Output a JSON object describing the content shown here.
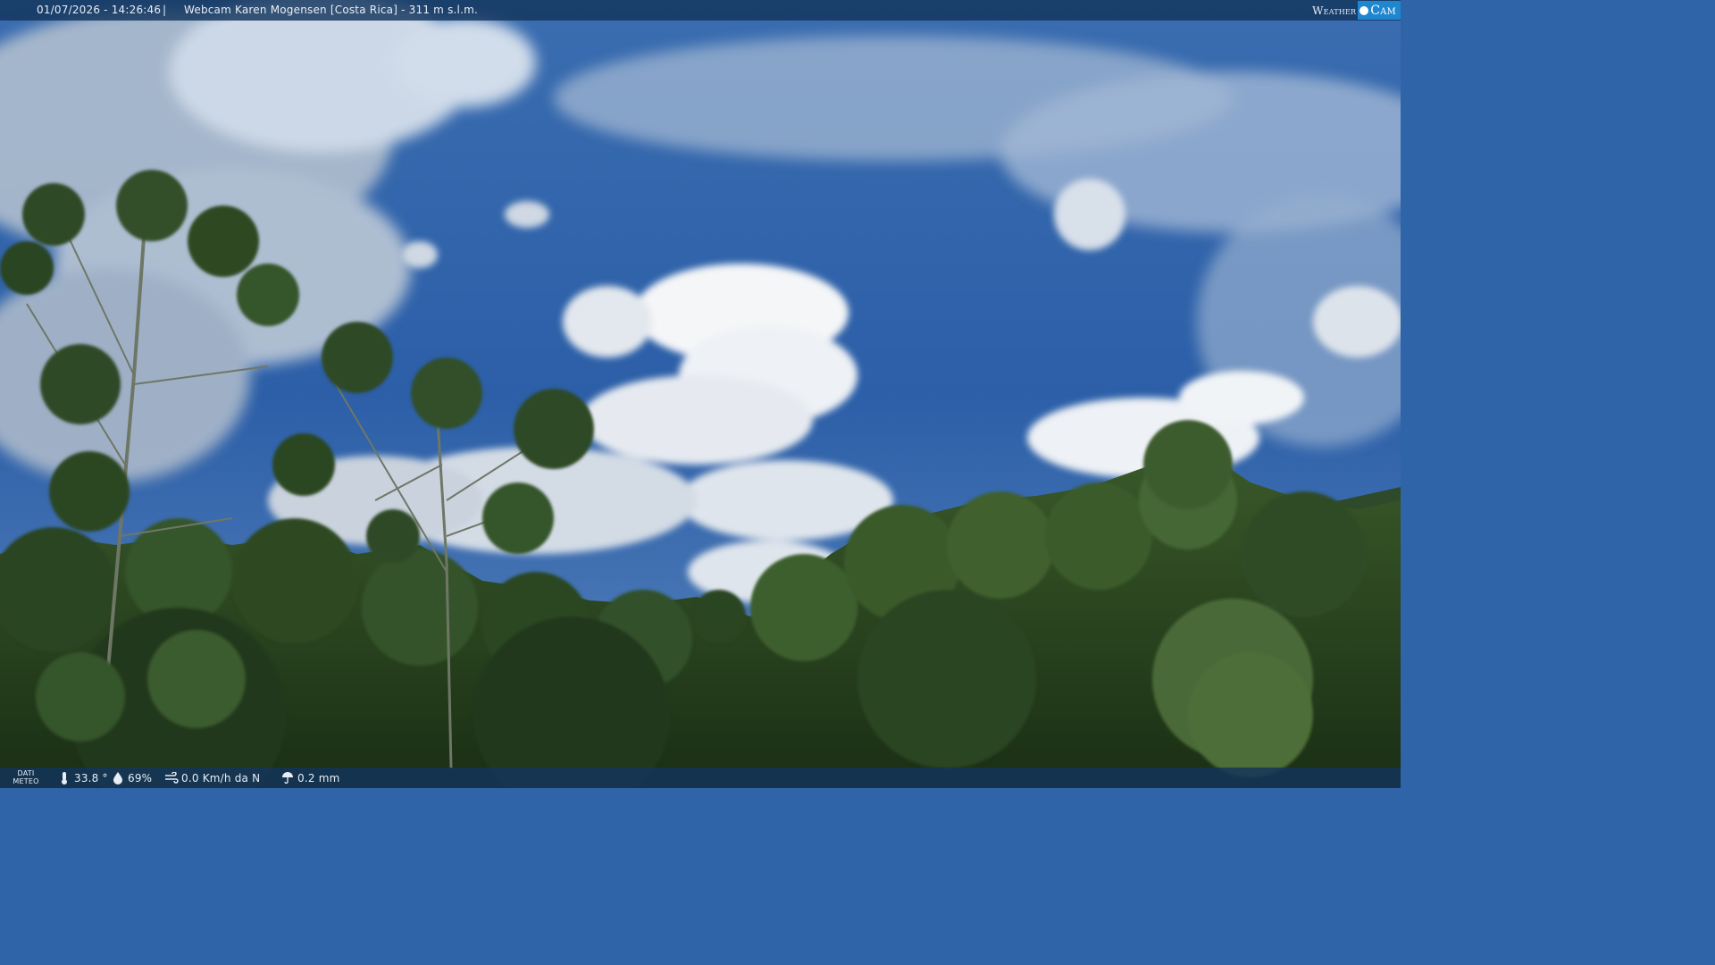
{
  "overlay": {
    "timestamp": "01/07/2026 - 14:26:46",
    "separator": "|",
    "camera_title": "Webcam Karen Mogensen [Costa Rica]  - 311 m s.l.m.",
    "logo_weather": "Weather",
    "logo_cam": "Cam"
  },
  "weather": {
    "label_line1": "DATI",
    "label_line2": "METEO",
    "temperature": "33.8 °",
    "humidity": "69%",
    "wind": "0.0 Km/h da N",
    "rain": "0.2 mm"
  },
  "colors": {
    "bar_bg": "#12345c",
    "logo_accent": "#1f86d0",
    "sky": "#2f64a8",
    "foliage": "#1f3a18"
  }
}
